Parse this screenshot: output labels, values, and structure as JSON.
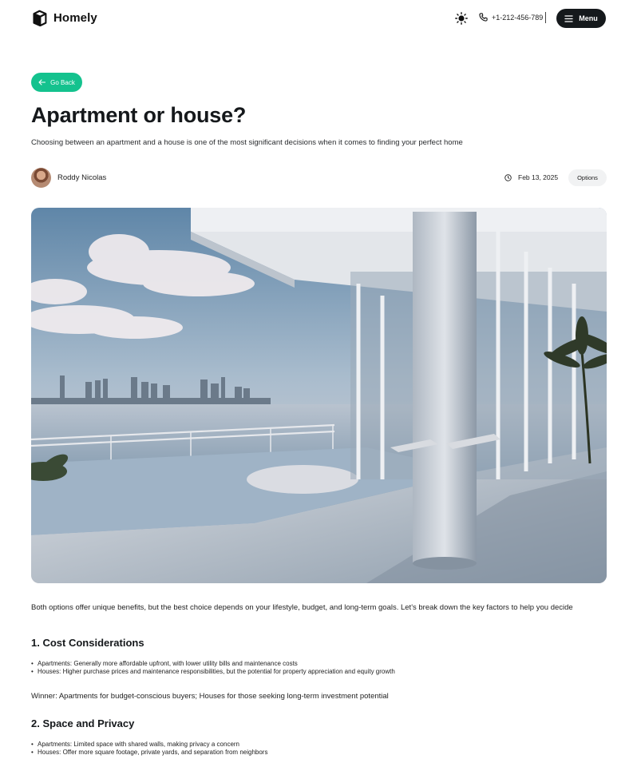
{
  "header": {
    "brand": "Homely",
    "phone": "+1-212-456-789",
    "menu_label": "Menu"
  },
  "back_label": "Go Back",
  "article": {
    "title": "Apartment or house?",
    "subtitle": "Choosing between an apartment and a house is one of the most significant decisions when it comes to finding your perfect home",
    "author": "Roddy Nicolas",
    "date": "Feb 13, 2025",
    "options_label": "Options",
    "intro": "Both options offer unique benefits, but the best choice depends on your lifestyle, budget, and long-term goals. Let's break down the key factors to help you decide",
    "sections": [
      {
        "heading": "1. Cost Considerations",
        "bullets": [
          "Apartments: Generally more affordable upfront, with lower utility bills and maintenance costs",
          "Houses: Higher purchase prices and maintenance responsibilities, but the potential for property appreciation and equity growth"
        ],
        "note": "Winner: Apartments for budget-conscious buyers; Houses for those seeking long-term investment potential"
      },
      {
        "heading": "2. Space and Privacy",
        "bullets": [
          "Apartments: Limited space with shared walls, making privacy a concern",
          "Houses: Offer more square footage, private yards, and separation from neighbors"
        ]
      }
    ]
  },
  "colors": {
    "accent": "#14c28e",
    "dark": "#15191c"
  },
  "icons": [
    "logo-icon",
    "sun-icon",
    "phone-icon",
    "menu-icon",
    "arrow-left-icon",
    "clock-icon"
  ]
}
